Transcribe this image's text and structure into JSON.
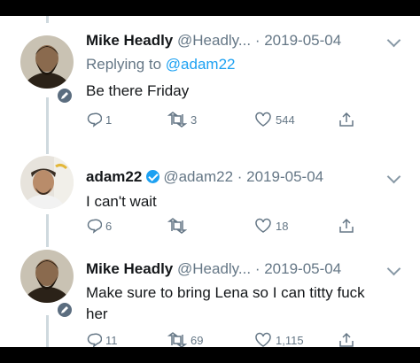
{
  "thread": [
    {
      "name": "Mike Headly",
      "handle": "@Headly...",
      "separator": " · ",
      "date": "2019-05-04",
      "replying_prefix": "Replying to ",
      "replying_to": "@adam22",
      "text": "Be there Friday",
      "reply_count": "1",
      "retweet_count": "3",
      "like_count": "544",
      "verified": false,
      "badge_icon": "pencil-icon",
      "avatar_icon": "bearded-man-avatar"
    },
    {
      "name": "adam22",
      "handle": "@adam22",
      "separator": " · ",
      "date": "2019-05-04",
      "text": "I can't wait",
      "reply_count": "6",
      "retweet_count": "",
      "like_count": "18",
      "verified": true,
      "avatar_icon": "man-with-cap-avatar"
    },
    {
      "name": "Mike Headly",
      "handle": "@Headly...",
      "separator": " · ",
      "date": "2019-05-04",
      "text": "Make sure to bring Lena so I can titty fuck her",
      "reply_count": "11",
      "retweet_count": "69",
      "like_count": "1,115",
      "verified": false,
      "badge_icon": "pencil-icon",
      "avatar_icon": "bearded-man-avatar"
    }
  ],
  "colors": {
    "name": "#14171a",
    "muted": "#657786",
    "link": "#1da1f2",
    "divider": "#cfd9de",
    "frame": "#000000"
  }
}
